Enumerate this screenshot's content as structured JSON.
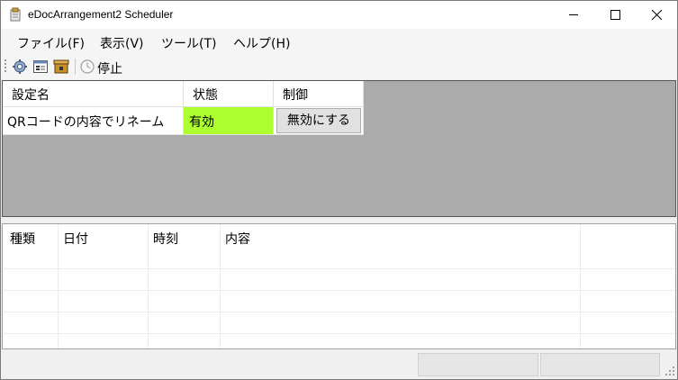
{
  "window": {
    "title": "eDocArrangement2 Scheduler"
  },
  "menu": [
    "ファイル(F)",
    "表示(V)",
    "ツール(T)",
    "ヘルプ(H)"
  ],
  "toolbar": {
    "stop_label": "停止"
  },
  "upper_grid": {
    "headers": [
      "設定名",
      "状態",
      "制御"
    ],
    "rows": [
      {
        "name": "QRコードの内容でリネーム",
        "status": "有効",
        "control": "無効にする",
        "status_color": "#adff2f"
      }
    ]
  },
  "lower_grid": {
    "headers": [
      "種類",
      "日付",
      "時刻",
      "内容"
    ]
  }
}
